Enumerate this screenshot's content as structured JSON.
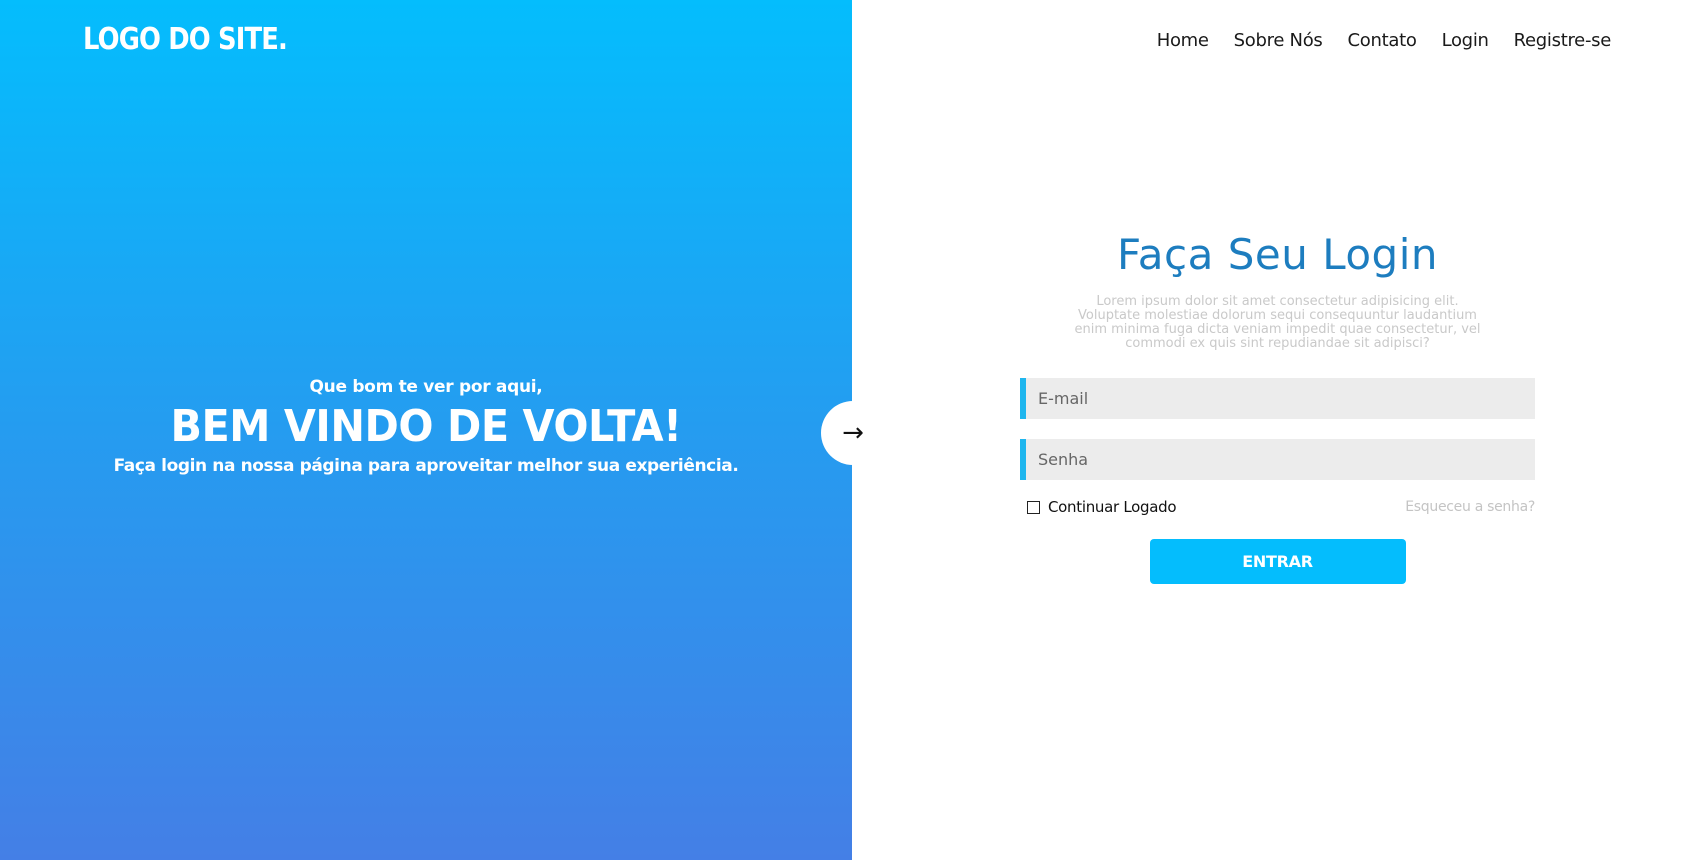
{
  "brand": {
    "logo_text": "LOGO DO SITE."
  },
  "nav": {
    "items": [
      {
        "label": "Home"
      },
      {
        "label": "Sobre Nós"
      },
      {
        "label": "Contato"
      },
      {
        "label": "Login"
      },
      {
        "label": "Registre-se"
      }
    ]
  },
  "welcome": {
    "subtitle": "Que bom te ver por aqui,",
    "title": "BEM VINDO DE VOLTA!",
    "description": "Faça login na nossa página para aproveitar melhor sua experiência."
  },
  "toggle": {
    "icon": "arrow-right-icon",
    "glyph": "→"
  },
  "login": {
    "title": "Faça Seu Login",
    "description": "Lorem ipsum dolor sit amet consectetur adipisicing elit. Voluptate molestiae dolorum sequi consequuntur laudantium enim minima fuga dicta veniam impedit quae consectetur, vel commodi ex quis sint repudiandae sit adipisci?",
    "email": {
      "value": "",
      "placeholder": "E-mail"
    },
    "password": {
      "value": "",
      "placeholder": "Senha"
    },
    "remember_label": "Continuar Logado",
    "remember_checked": false,
    "forgot_label": "Esqueceu a senha?",
    "submit_label": "ENTRAR"
  },
  "colors": {
    "gradient_top": "#04bdfd",
    "gradient_bottom": "#447fe6",
    "accent": "#04bdfd",
    "title": "#1d7dbf",
    "field_bg": "#ececec",
    "field_accent": "#1fb6ee"
  }
}
